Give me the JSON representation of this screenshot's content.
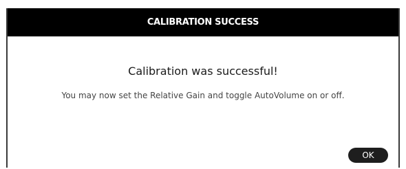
{
  "dialog": {
    "title": "CALIBRATION SUCCESS",
    "heading": "Calibration was successful!",
    "message": "You may now set the Relative Gain and toggle AutoVolume on or off.",
    "ok_label": "OK"
  },
  "colors": {
    "titlebar_bg": "#000000",
    "title_text": "#ffffff",
    "button_bg": "#1e1e1e",
    "heading_text": "#1a1a1a",
    "message_text": "#444444"
  }
}
